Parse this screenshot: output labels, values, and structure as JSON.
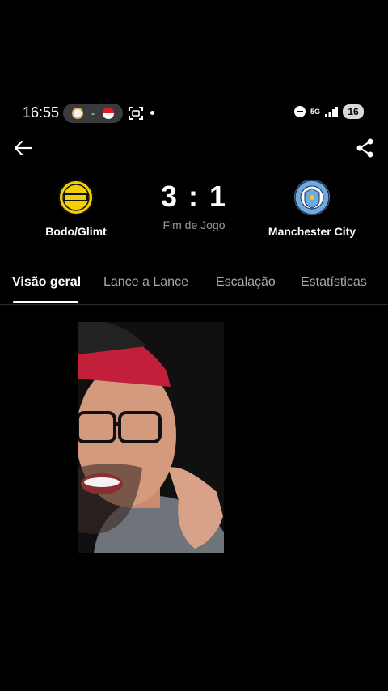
{
  "status_bar": {
    "time": "16:55",
    "match_separator": "-",
    "battery": "16",
    "network": "5G"
  },
  "match": {
    "home_team": "Bodo/Glimt",
    "away_team": "Manchester City",
    "score": "3 : 1",
    "status": "Fim de Jogo"
  },
  "tabs": [
    {
      "label": "Visão geral"
    },
    {
      "label": "Lance a Lance"
    },
    {
      "label": "Escalação"
    },
    {
      "label": "Estatísticas"
    }
  ],
  "colors": {
    "background": "#000000",
    "glimt_yellow": "#f5d000",
    "city_blue": "#6cabdd",
    "tab_inactive": "#a8a8a8"
  },
  "icons": {
    "back": "arrow-left-icon",
    "share": "share-icon"
  }
}
